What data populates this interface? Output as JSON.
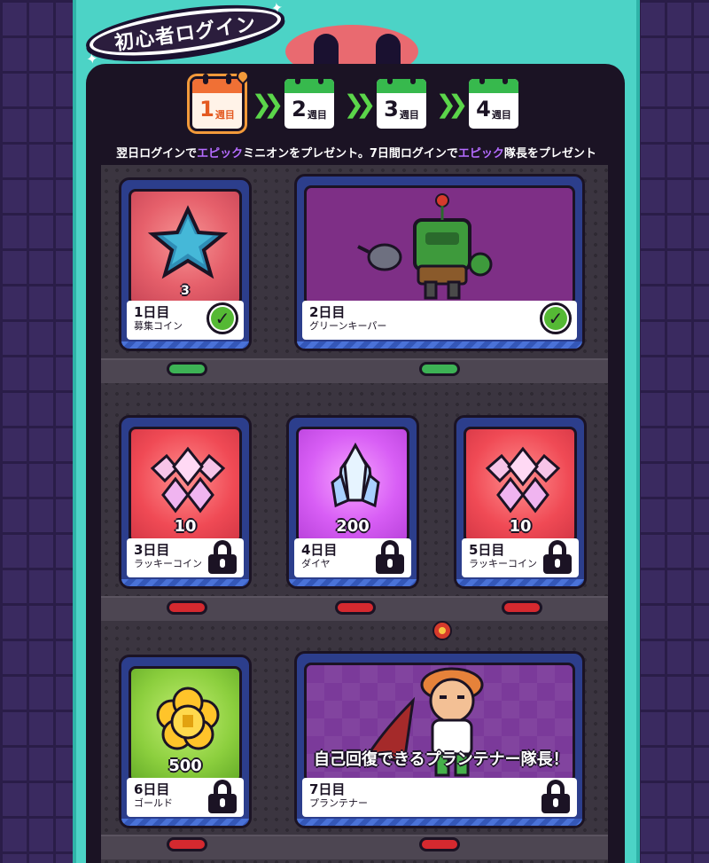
{
  "title": "初心者ログイン",
  "weeks": [
    {
      "num": "1",
      "suffix": "週目",
      "active": true
    },
    {
      "num": "2",
      "suffix": "週目",
      "active": false
    },
    {
      "num": "3",
      "suffix": "週目",
      "active": false
    },
    {
      "num": "4",
      "suffix": "週目",
      "active": false
    }
  ],
  "info": {
    "part1": "翌日ログインで",
    "epic1": "エピック",
    "part2": "ミニオンをプレゼント。7日間ログインで",
    "epic2": "エピック",
    "part3": "隊長をプレゼント"
  },
  "days": [
    {
      "day": "1日目",
      "name": "募集コイン",
      "amount": "3",
      "status": "claimed"
    },
    {
      "day": "2日目",
      "name": "グリーンキーパー",
      "amount": "",
      "status": "claimed"
    },
    {
      "day": "3日目",
      "name": "ラッキーコイン",
      "amount": "10",
      "status": "locked"
    },
    {
      "day": "4日目",
      "name": "ダイヤ",
      "amount": "200",
      "status": "locked"
    },
    {
      "day": "5日目",
      "name": "ラッキーコイン",
      "amount": "10",
      "status": "locked"
    },
    {
      "day": "6日目",
      "name": "ゴールド",
      "amount": "500",
      "status": "locked"
    },
    {
      "day": "7日目",
      "name": "プランテナー",
      "amount": "",
      "status": "locked",
      "promo": "自己回復できるプランテナー隊長！"
    }
  ],
  "colors": {
    "panel": "#4cd3c6",
    "board": "#1b1324",
    "epic": "#b56cff",
    "claimed_lamp": "#3db255",
    "locked_lamp": "#d5292f"
  }
}
